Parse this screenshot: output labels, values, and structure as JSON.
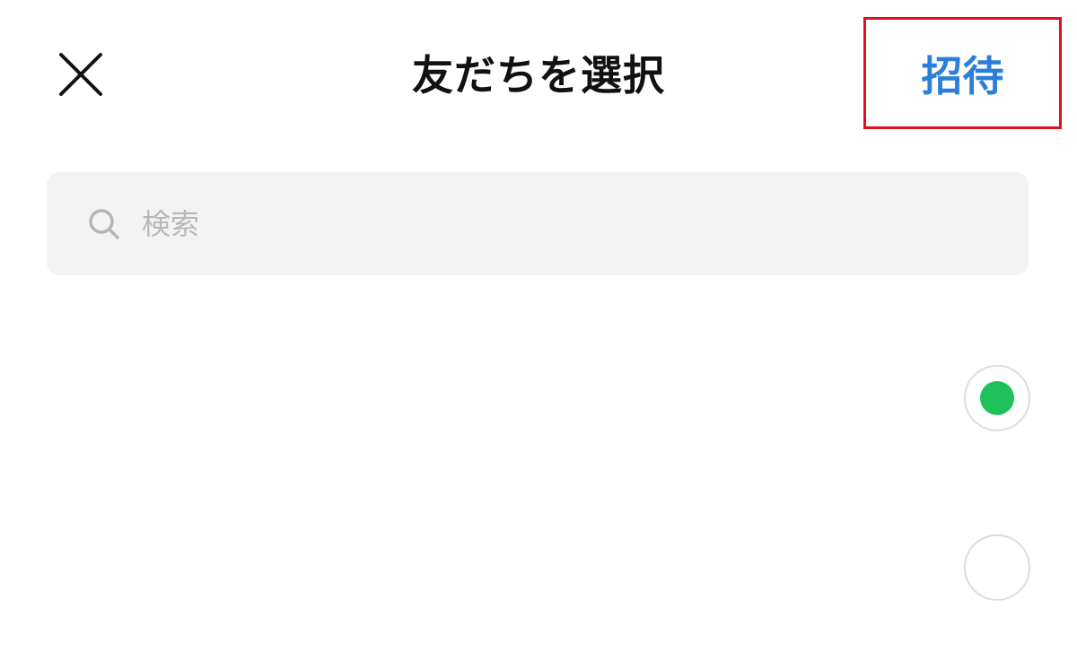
{
  "header": {
    "title": "友だちを選択",
    "invite_label": "招待",
    "close_icon": "close-icon"
  },
  "search": {
    "placeholder": "検索",
    "value": "",
    "icon": "search-icon"
  },
  "friends": [
    {
      "selected": true
    },
    {
      "selected": false
    }
  ],
  "colors": {
    "invite_text": "#2b7fd9",
    "highlight_box": "#e0101c",
    "selected_dot": "#1ec15a",
    "search_bg": "#f3f3f3"
  }
}
